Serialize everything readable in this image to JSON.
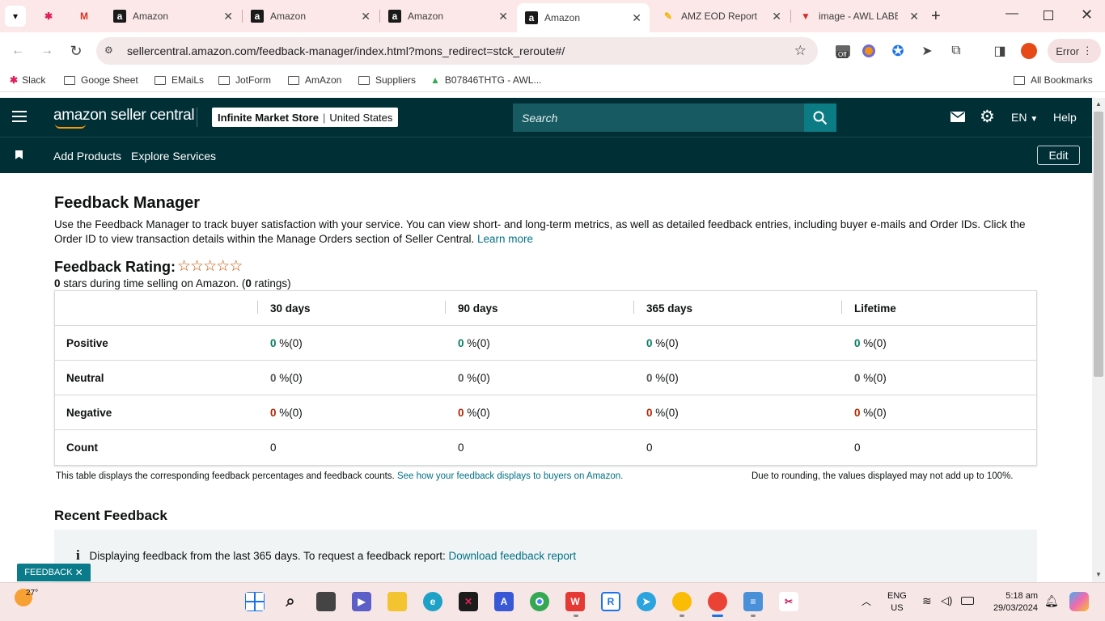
{
  "browser": {
    "tabs": [
      {
        "title": "",
        "icon": "slack-icon"
      },
      {
        "title": "",
        "icon": "gmail-icon"
      },
      {
        "title": "Amazon",
        "icon": "amazon-icon"
      },
      {
        "title": "Amazon",
        "icon": "amazon-icon"
      },
      {
        "title": "Amazon",
        "icon": "amazon-icon"
      },
      {
        "title": "Amazon",
        "icon": "amazon-icon",
        "active": true
      },
      {
        "title": "AMZ EOD Report",
        "icon": "sheets-icon"
      },
      {
        "title": "image - AWL LABE",
        "icon": "vivaldi-icon"
      }
    ],
    "url": "sellercentral.amazon.com/feedback-manager/index.html?mons_redirect=stck_reroute#/",
    "error_label": "Error",
    "bookmarks": [
      "Slack",
      "Googe Sheet",
      "EMaiLs",
      "JotForm",
      "AmAzon",
      "Suppliers",
      "B07846THTG - AWL..."
    ],
    "all_bookmarks": "All Bookmarks",
    "ext_badge": "Off"
  },
  "header": {
    "logo": "amazon seller central",
    "store_name": "Infinite Market Store",
    "store_region": "United States",
    "search_placeholder": "Search",
    "language": "EN",
    "help": "Help"
  },
  "subnav": {
    "items": [
      "Add Products",
      "Explore Services"
    ],
    "edit": "Edit"
  },
  "page": {
    "title": "Feedback Manager",
    "intro": "Use the Feedback Manager to track buyer satisfaction with your service. You can view short- and long-term metrics, as well as detailed feedback entries, including buyer e-mails and Order IDs. Click the Order ID to view transaction details within the Manage Orders section of Seller Central.",
    "learn_more": "Learn more",
    "rating_label": "Feedback Rating:",
    "rating_stars": 0,
    "rating_stars_max": 5,
    "stars_value": "0",
    "stars_text_mid": " stars during time selling on Amazon. (",
    "ratings_count": "0",
    "ratings_text_end": " ratings)",
    "table": {
      "columns": [
        "30 days",
        "90 days",
        "365 days",
        "Lifetime"
      ],
      "rows": [
        {
          "label": "Positive",
          "cells": [
            {
              "v": "0",
              "p": " %(0)"
            },
            {
              "v": "0",
              "p": " %(0)"
            },
            {
              "v": "0",
              "p": " %(0)"
            },
            {
              "v": "0",
              "p": " %(0)"
            }
          ]
        },
        {
          "label": "Neutral",
          "cells": [
            {
              "v": "0",
              "p": " %(0)"
            },
            {
              "v": "0",
              "p": " %(0)"
            },
            {
              "v": "0",
              "p": " %(0)"
            },
            {
              "v": "0",
              "p": " %(0)"
            }
          ]
        },
        {
          "label": "Negative",
          "cells": [
            {
              "v": "0",
              "p": " %(0)"
            },
            {
              "v": "0",
              "p": " %(0)"
            },
            {
              "v": "0",
              "p": " %(0)"
            },
            {
              "v": "0",
              "p": " %(0)"
            }
          ]
        },
        {
          "label": "Count",
          "cells": [
            {
              "v": "0"
            },
            {
              "v": "0"
            },
            {
              "v": "0"
            },
            {
              "v": "0"
            }
          ]
        }
      ]
    },
    "footnote_left": "This table displays the corresponding feedback percentages and feedback counts.",
    "footnote_link": "See how your feedback displays to buyers on Amazon.",
    "footnote_right": "Due to rounding, the values displayed may not add up to 100%.",
    "recent_title": "Recent Feedback",
    "info_text": "Displaying feedback from the last 365 days. To request a feedback report:",
    "info_link": "Download feedback report",
    "feedback_tag": "FEEDBACK"
  },
  "taskbar": {
    "weather": "27°",
    "lang_top": "ENG",
    "lang_bottom": "US",
    "time": "5:18 am",
    "date": "29/03/2024"
  },
  "colors": {
    "header_bg": "#002f36",
    "link": "#007185",
    "positive": "#067d62",
    "negative": "#b12704",
    "tab_strip": "#fce8e8"
  }
}
